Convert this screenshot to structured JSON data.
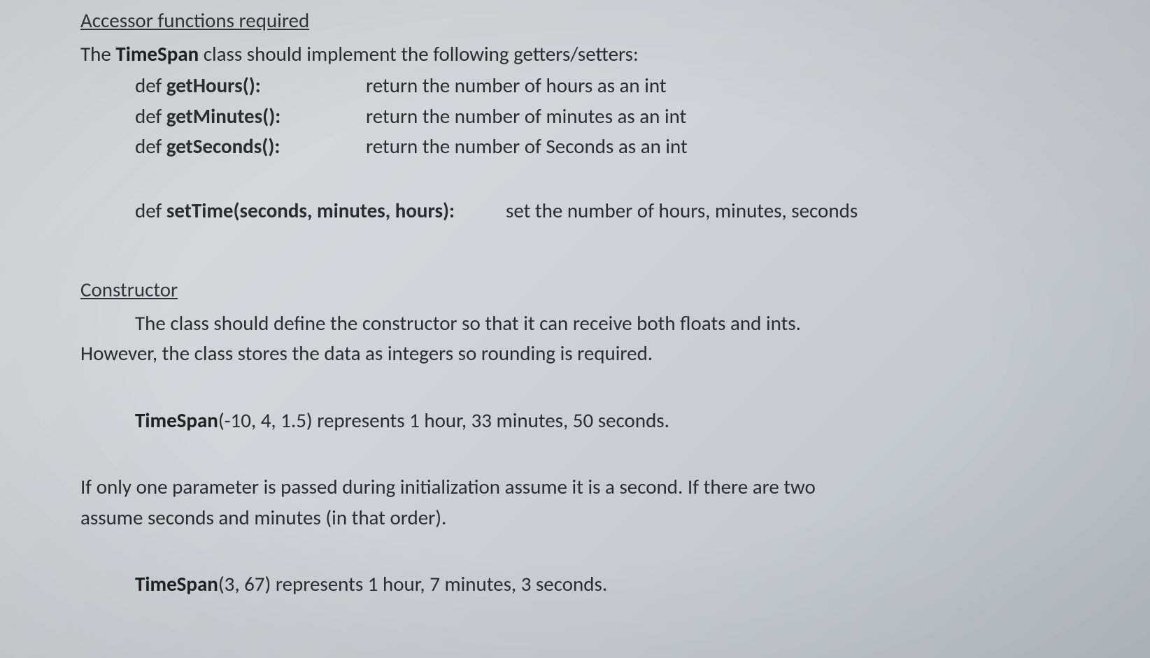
{
  "section1": {
    "heading": "Accessor functions required",
    "intro_pre": "The ",
    "intro_bold": "TimeSpan",
    "intro_post": " class should implement the following getters/setters:",
    "methods": [
      {
        "def": "def ",
        "name": "getHours():",
        "desc": "return the number of hours as an int"
      },
      {
        "def": "def ",
        "name": "getMinutes():",
        "desc": "return the number of minutes as an int"
      },
      {
        "def": "def ",
        "name": "getSeconds():",
        "desc": "return the number of Seconds as an int"
      }
    ],
    "settime": {
      "def": "def ",
      "name": "setTime(seconds, minutes, hours):",
      "desc": "set the number of hours, minutes, seconds"
    }
  },
  "section2": {
    "heading": "Constructor",
    "para_line1": "The class should define the constructor so that it can receive both floats and ints.",
    "para_line2": "However, the class stores the data as integers so rounding is required.",
    "example1_bold": "TimeSpan",
    "example1_rest": "(-10, 4, 1.5) represents 1 hour, 33 minutes, 50 seconds.",
    "follow_line1": "If only one parameter is passed during initialization assume it is a second.  If there are two",
    "follow_line2": "assume seconds and minutes (in that order).",
    "example2_bold": "TimeSpan",
    "example2_rest": "(3, 67) represents 1 hour, 7 minutes, 3 seconds."
  }
}
